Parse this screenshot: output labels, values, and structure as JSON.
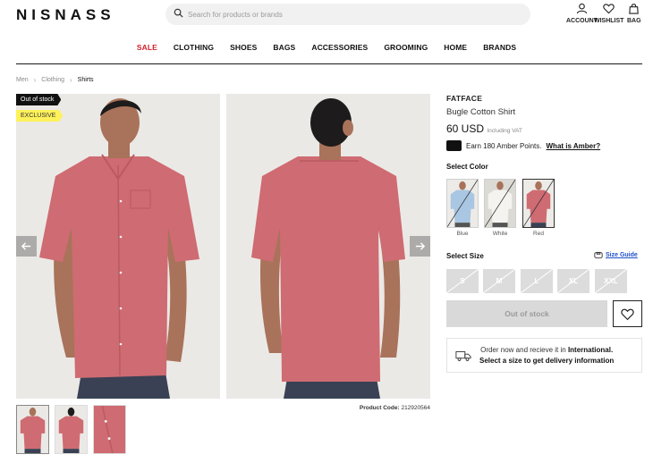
{
  "header": {
    "logo": "NISNASS",
    "search_placeholder": "Search for products or brands",
    "account_label": "ACCOUNT",
    "wishlist_label": "WISHLIST",
    "bag_label": "BAG"
  },
  "nav": {
    "items": [
      "SALE",
      "CLOTHING",
      "SHOES",
      "BAGS",
      "ACCESSORIES",
      "GROOMING",
      "HOME",
      "BRANDS"
    ]
  },
  "breadcrumb": [
    "Men",
    "Clothing",
    "Shirts"
  ],
  "gallery": {
    "tag_stock": "Out of stock",
    "tag_exclusive": "EXCLUSIVE",
    "product_code_label": "Product Code:",
    "product_code": "212920564"
  },
  "product": {
    "brand": "FATFACE",
    "name": "Bugle Cotton Shirt",
    "price": "60 USD",
    "vat_note": "Including VAT",
    "amber_text": "Earn 180 Amber Points.",
    "amber_link": "What is Amber?"
  },
  "color": {
    "label": "Select Color",
    "options": [
      "Blue",
      "White",
      "Red"
    ],
    "selected": "Red"
  },
  "size": {
    "label": "Select Size",
    "guide_label": "Size Guide",
    "options": [
      "S",
      "M",
      "L",
      "XL",
      "XXL"
    ],
    "all_unavailable": true
  },
  "actions": {
    "out_of_stock_label": "Out of stock"
  },
  "delivery": {
    "line1_prefix": "Order now and recieve it in",
    "line1_place": "International.",
    "line2": "Select a size to get delivery information"
  },
  "colors": {
    "sale_red": "#d0202a",
    "shirt_red": "#cf6b72",
    "exclusive_yellow": "#fff15a",
    "link_blue": "#1e4fc9"
  },
  "icons": [
    "search-icon",
    "account-icon",
    "heart-icon",
    "bag-icon",
    "chevron-right-icon",
    "arrow-left-icon",
    "arrow-right-icon",
    "ruler-icon",
    "truck-icon",
    "card-icon"
  ]
}
